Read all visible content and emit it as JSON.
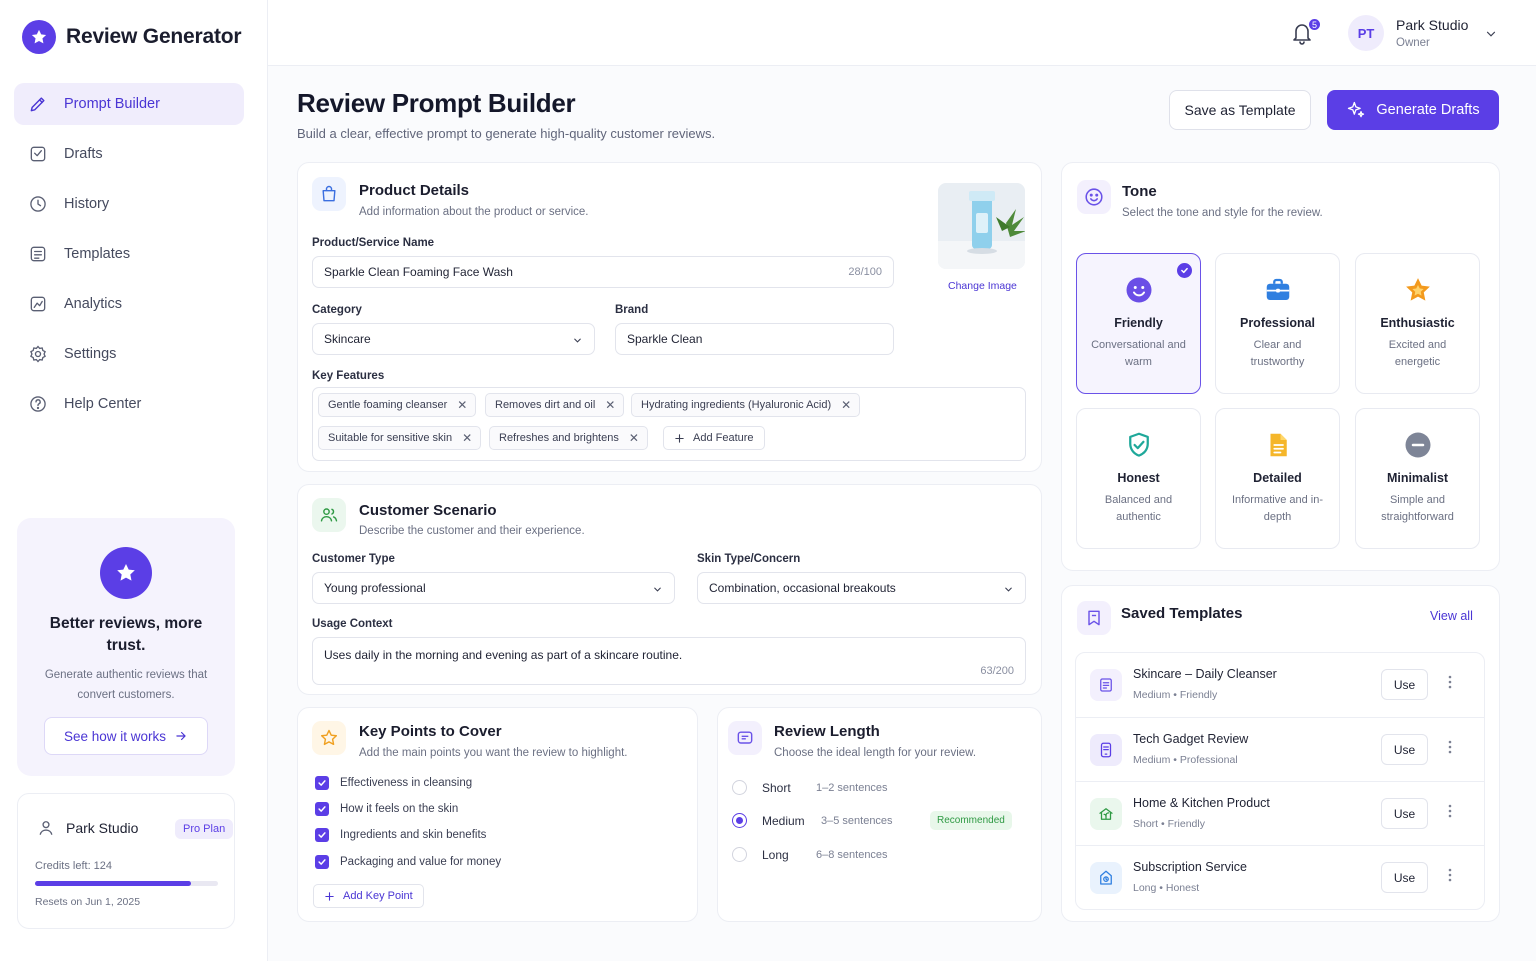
{
  "app": {
    "name": "Review Generator"
  },
  "sidebar": {
    "items": [
      {
        "label": "Prompt Builder",
        "icon": "pencil-icon",
        "active": true
      },
      {
        "label": "Drafts",
        "icon": "drafts-icon"
      },
      {
        "label": "History",
        "icon": "clock-icon"
      },
      {
        "label": "Templates",
        "icon": "templates-icon"
      },
      {
        "label": "Analytics",
        "icon": "analytics-icon"
      },
      {
        "label": "Settings",
        "icon": "gear-icon"
      },
      {
        "label": "Help Center",
        "icon": "help-icon"
      }
    ],
    "promo": {
      "title": "Better reviews, more trust.",
      "text": "Generate authentic reviews that convert customers.",
      "button": "See how it works"
    },
    "account": {
      "name": "Park Studio",
      "plan": "Pro Plan",
      "credits": "Credits left: 124",
      "credits_fraction": 0.85,
      "resets": "Resets on Jun 1, 2025"
    }
  },
  "topbar": {
    "notifications": "5",
    "avatar_initials": "PT",
    "user_name": "Park Studio",
    "user_role": "Owner"
  },
  "header": {
    "title": "Review Prompt Builder",
    "subtitle": "Build a clear, effective prompt to generate high-quality customer reviews.",
    "save_template": "Save as Template",
    "generate": "Generate Drafts"
  },
  "product": {
    "title": "Product Details",
    "subtitle": "Add information about the product or service.",
    "name_label": "Product/Service Name",
    "name_value": "Sparkle Clean Foaming Face Wash",
    "name_counter": "28/100",
    "category_label": "Category",
    "category_value": "Skincare",
    "brand_label": "Brand",
    "brand_value": "Sparkle Clean",
    "features_label": "Key Features",
    "features": [
      "Gentle foaming cleanser",
      "Removes dirt and oil",
      "Hydrating ingredients (Hyaluronic Acid)",
      "Suitable for sensitive skin",
      "Refreshes and brightens"
    ],
    "add_feature": "Add Feature",
    "change_image": "Change Image"
  },
  "scenario": {
    "title": "Customer Scenario",
    "subtitle": "Describe the customer and their experience.",
    "customer_type_label": "Customer Type",
    "customer_type_value": "Young professional",
    "skin_label": "Skin Type/Concern",
    "skin_value": "Combination, occasional breakouts",
    "usage_label": "Usage Context",
    "usage_value": "Uses daily in the morning and evening as part of a skincare routine.",
    "usage_counter": "63/200"
  },
  "keypoints": {
    "title": "Key Points to Cover",
    "subtitle": "Add the main points you want the review to highlight.",
    "items": [
      "Effectiveness in cleansing",
      "How it feels on the skin",
      "Ingredients and skin benefits",
      "Packaging and value for money"
    ],
    "add": "Add Key Point"
  },
  "length": {
    "title": "Review Length",
    "subtitle": "Choose the ideal length for your review.",
    "options": [
      {
        "label": "Short",
        "hint": "1–2 sentences",
        "selected": false
      },
      {
        "label": "Medium",
        "hint": "3–5 sentences",
        "selected": true
      },
      {
        "label": "Long",
        "hint": "6–8 sentences",
        "selected": false
      }
    ],
    "recommended": "Recommended"
  },
  "tone": {
    "title": "Tone",
    "subtitle": "Select the tone and style for the review.",
    "options": [
      {
        "name": "Friendly",
        "desc": "Conversational and warm",
        "icon": "smile-icon",
        "selected": true
      },
      {
        "name": "Professional",
        "desc": "Clear and trustworthy",
        "icon": "briefcase-icon"
      },
      {
        "name": "Enthusiastic",
        "desc": "Excited and energetic",
        "icon": "star-icon"
      },
      {
        "name": "Honest",
        "desc": "Balanced and authentic",
        "icon": "shield-check-icon"
      },
      {
        "name": "Detailed",
        "desc": "Informative and in-depth",
        "icon": "document-icon"
      },
      {
        "name": "Minimalist",
        "desc": "Simple and straightforward",
        "icon": "minus-circle-icon"
      }
    ]
  },
  "templates": {
    "title": "Saved Templates",
    "view_all": "View all",
    "use_label": "Use",
    "items": [
      {
        "name": "Skincare – Daily Cleanser",
        "length": "Medium",
        "tone": "Friendly"
      },
      {
        "name": "Tech Gadget Review",
        "length": "Medium",
        "tone": "Professional"
      },
      {
        "name": "Home & Kitchen Product",
        "length": "Short",
        "tone": "Friendly"
      },
      {
        "name": "Subscription Service",
        "length": "Long",
        "tone": "Honest"
      }
    ]
  },
  "colors": {
    "accent": "#5b3ee6",
    "success": "#2f9a44"
  }
}
